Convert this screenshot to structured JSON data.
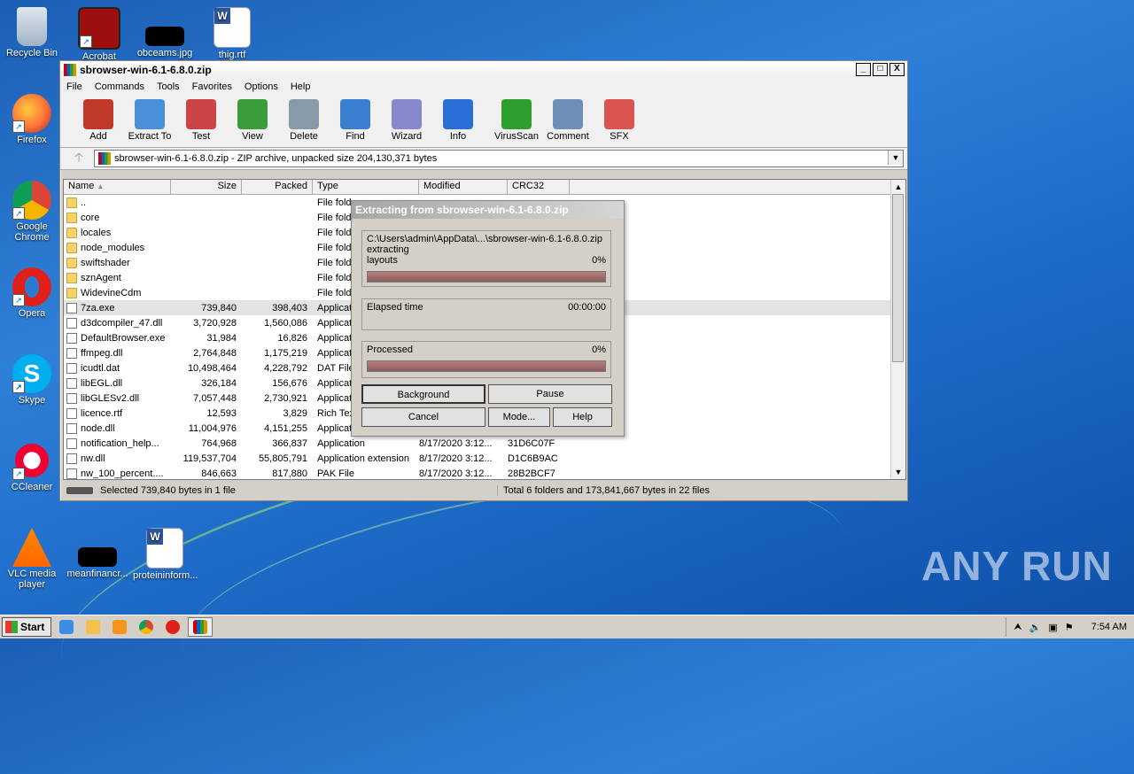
{
  "desktop": {
    "icons": [
      {
        "label": "Recycle Bin"
      },
      {
        "label": "Acrobat"
      },
      {
        "label": "obceams.jpg"
      },
      {
        "label": "thig.rtf"
      },
      {
        "label": "Firefox"
      },
      {
        "label": "Google Chrome"
      },
      {
        "label": "Opera"
      },
      {
        "label": "Skype"
      },
      {
        "label": "CCleaner"
      },
      {
        "label": "VLC media player"
      },
      {
        "label": "meanfinancr..."
      },
      {
        "label": "proteininform..."
      }
    ],
    "watermark": "ANY RUN"
  },
  "window": {
    "title": "sbrowser-win-6.1-6.8.0.zip",
    "controls": {
      "min": "_",
      "max": "□",
      "close": "X"
    },
    "menu": [
      "File",
      "Commands",
      "Tools",
      "Favorites",
      "Options",
      "Help"
    ],
    "toolbar": [
      "Add",
      "Extract To",
      "Test",
      "View",
      "Delete",
      "Find",
      "Wizard",
      "Info",
      "VirusScan",
      "Comment",
      "SFX"
    ],
    "toolbar_colors": [
      "#c0392b",
      "#4a90d9",
      "#c44",
      "#3a9d3a",
      "#8899aa",
      "#3b7fd0",
      "#88c",
      "#2a6fd6",
      "#2e9e2e",
      "#6d8fb8",
      "#d9534f"
    ],
    "address": "sbrowser-win-6.1-6.8.0.zip - ZIP archive, unpacked size 204,130,371 bytes",
    "columns": [
      "Name",
      "Size",
      "Packed",
      "Type",
      "Modified",
      "CRC32"
    ],
    "rows": [
      {
        "name": "..",
        "size": "",
        "packed": "",
        "type": "File fold",
        "mod": "",
        "crc": "",
        "kind": "folder"
      },
      {
        "name": "core",
        "size": "",
        "packed": "",
        "type": "File fold",
        "mod": "",
        "crc": "",
        "kind": "folder"
      },
      {
        "name": "locales",
        "size": "",
        "packed": "",
        "type": "File fold",
        "mod": "",
        "crc": "",
        "kind": "folder"
      },
      {
        "name": "node_modules",
        "size": "",
        "packed": "",
        "type": "File fold",
        "mod": "",
        "crc": "",
        "kind": "folder"
      },
      {
        "name": "swiftshader",
        "size": "",
        "packed": "",
        "type": "File fold",
        "mod": "",
        "crc": "",
        "kind": "folder"
      },
      {
        "name": "sznAgent",
        "size": "",
        "packed": "",
        "type": "File fold",
        "mod": "",
        "crc": "",
        "kind": "folder"
      },
      {
        "name": "WidevineCdm",
        "size": "",
        "packed": "",
        "type": "File fold",
        "mod": "",
        "crc": "",
        "kind": "folder"
      },
      {
        "name": "7za.exe",
        "size": "739,840",
        "packed": "398,403",
        "type": "Applicat",
        "mod": "",
        "crc": "",
        "kind": "file",
        "selected": true
      },
      {
        "name": "d3dcompiler_47.dll",
        "size": "3,720,928",
        "packed": "1,560,086",
        "type": "Applicat",
        "mod": "",
        "crc": "",
        "kind": "file"
      },
      {
        "name": "DefaultBrowser.exe",
        "size": "31,984",
        "packed": "16,826",
        "type": "Applicat",
        "mod": "",
        "crc": "",
        "kind": "file"
      },
      {
        "name": "ffmpeg.dll",
        "size": "2,764,848",
        "packed": "1,175,219",
        "type": "Applicat",
        "mod": "",
        "crc": "",
        "kind": "file"
      },
      {
        "name": "icudtl.dat",
        "size": "10,498,464",
        "packed": "4,228,792",
        "type": "DAT File",
        "mod": "",
        "crc": "",
        "kind": "file"
      },
      {
        "name": "libEGL.dll",
        "size": "326,184",
        "packed": "156,676",
        "type": "Applicat",
        "mod": "",
        "crc": "",
        "kind": "file"
      },
      {
        "name": "libGLESv2.dll",
        "size": "7,057,448",
        "packed": "2,730,921",
        "type": "Applicat",
        "mod": "",
        "crc": "",
        "kind": "file"
      },
      {
        "name": "licence.rtf",
        "size": "12,593",
        "packed": "3,829",
        "type": "Rich Tex",
        "mod": "",
        "crc": "",
        "kind": "file"
      },
      {
        "name": "node.dll",
        "size": "11,004,976",
        "packed": "4,151,255",
        "type": "Applicat",
        "mod": "",
        "crc": "",
        "kind": "file"
      },
      {
        "name": "notification_help...",
        "size": "764,968",
        "packed": "366,837",
        "type": "Application",
        "mod": "8/17/2020 3:12...",
        "crc": "31D6C07F",
        "kind": "file"
      },
      {
        "name": "nw.dll",
        "size": "119,537,704",
        "packed": "55,805,791",
        "type": "Application extension",
        "mod": "8/17/2020 3:12...",
        "crc": "D1C6B9AC",
        "kind": "file"
      },
      {
        "name": "nw_100_percent....",
        "size": "846,663",
        "packed": "817,880",
        "type": "PAK File",
        "mod": "8/17/2020 3:12...",
        "crc": "28B2BCF7",
        "kind": "file"
      }
    ],
    "status_left": "Selected 739,840 bytes in 1 file",
    "status_right": "Total 6 folders and 173,841,667 bytes in 22 files"
  },
  "dialog": {
    "title": "Extracting from sbrowser-win-6.1-6.8.0.zip",
    "path": "C:\\Users\\admin\\AppData\\...\\sbrowser-win-6.1-6.8.0.zip",
    "action": "extracting",
    "item": "layouts",
    "item_pct": "0%",
    "elapsed_label": "Elapsed time",
    "elapsed": "00:00:00",
    "processed_label": "Processed",
    "processed_pct": "0%",
    "progress_item": 0,
    "progress_total": 0,
    "buttons": {
      "background": "Background",
      "pause": "Pause",
      "cancel": "Cancel",
      "mode": "Mode...",
      "help": "Help"
    }
  },
  "taskbar": {
    "start": "Start",
    "clock": "7:54 AM"
  }
}
